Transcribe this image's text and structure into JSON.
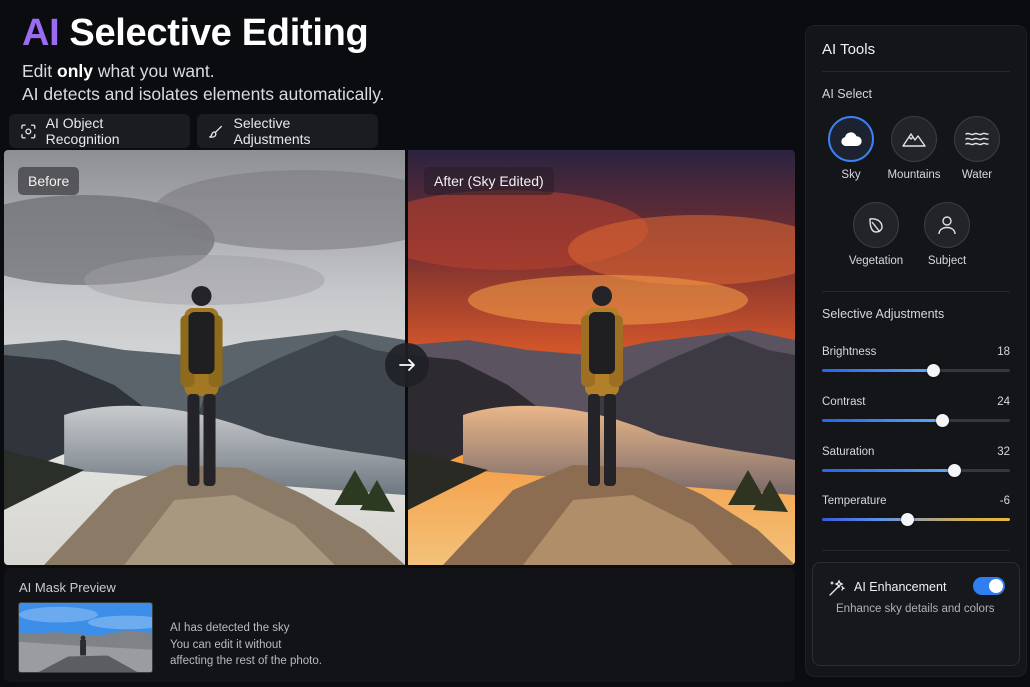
{
  "hero": {
    "title_accent": "AI",
    "title_rest": "Selective Editing",
    "subtitle_pre": "Edit ",
    "subtitle_bold": "only",
    "subtitle_post": " what you want.",
    "subtitle_line2": "AI detects and isolates elements automatically."
  },
  "features": [
    {
      "label": "AI Object Recognition",
      "icon": "scan-icon"
    },
    {
      "label": "Selective Adjustments",
      "icon": "brush-icon"
    }
  ],
  "comparison": {
    "before_label": "Before",
    "after_label": "After (Sky Edited)",
    "arrow_icon": "arrow-right-icon"
  },
  "mask_preview": {
    "title": "AI Mask Preview",
    "line1": "AI has detected the sky",
    "line2": "You can edit it without",
    "line3": "affecting the rest of the photo."
  },
  "panel": {
    "title": "AI Tools",
    "select_title": "AI Select",
    "tools": [
      {
        "label": "Sky",
        "icon": "cloud-icon",
        "active": true
      },
      {
        "label": "Mountains",
        "icon": "mountain-icon",
        "active": false
      },
      {
        "label": "Water",
        "icon": "waves-icon",
        "active": false
      },
      {
        "label": "Vegetation",
        "icon": "leaf-icon",
        "active": false
      },
      {
        "label": "Subject",
        "icon": "person-icon",
        "active": false
      }
    ],
    "adjust_title": "Selective Adjustments",
    "sliders": [
      {
        "label": "Brightness",
        "value": "18",
        "level": 0.59
      },
      {
        "label": "Contrast",
        "value": "24",
        "level": 0.64
      },
      {
        "label": "Saturation",
        "value": "32",
        "level": 0.7
      },
      {
        "label": "Temperature",
        "value": "-6",
        "level": 0.45
      }
    ],
    "enhancement": {
      "title": "AI Enhancement",
      "subtitle": "Enhance sky details and colors",
      "enabled": true
    }
  },
  "colors": {
    "accent_purple": "#9a6cf2",
    "accent_blue": "#3b82f6",
    "toggle_on": "#2f7ff1"
  }
}
